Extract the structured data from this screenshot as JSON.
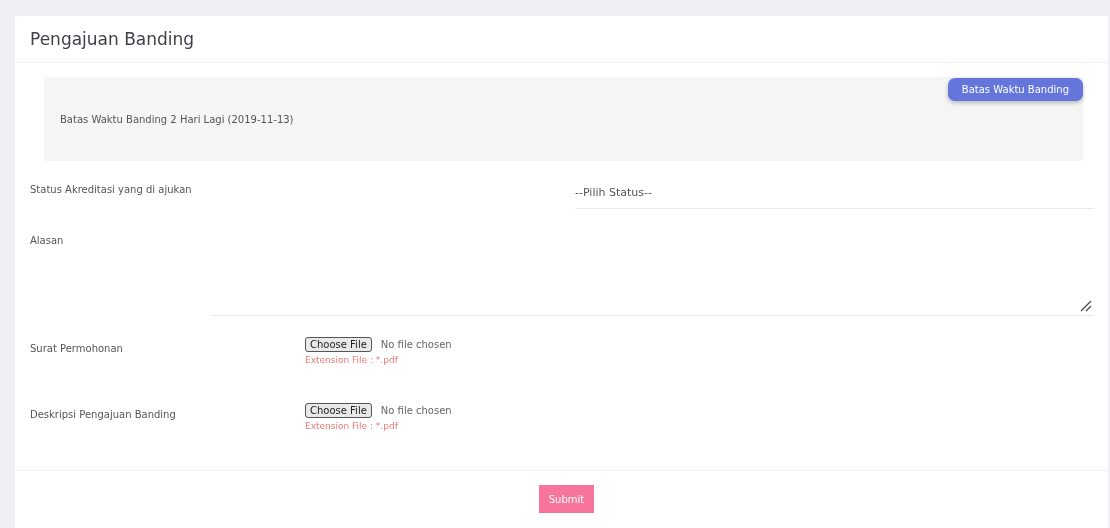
{
  "card": {
    "title": "Pengajuan Banding"
  },
  "deadline": {
    "button": "Batas Waktu Banding",
    "text": "Batas Waktu Banding 2 Hari Lagi (2019-11-13)"
  },
  "fields": [
    {
      "kind": "select",
      "label": "Status Akreditasi yang di ajukan",
      "value": "--Pilih Status--"
    },
    {
      "kind": "textarea",
      "label": "Alasan"
    },
    {
      "kind": "file",
      "label": "Surat Permohonan",
      "button": "Choose File",
      "status": "No file chosen",
      "hint": "Extension File : *.pdf"
    },
    {
      "kind": "file",
      "label": "Deskripsi Pengajuan Banding",
      "button": "Choose File",
      "status": "No file chosen",
      "hint": "Extension File : *.pdf"
    }
  ],
  "submit": "Submit"
}
